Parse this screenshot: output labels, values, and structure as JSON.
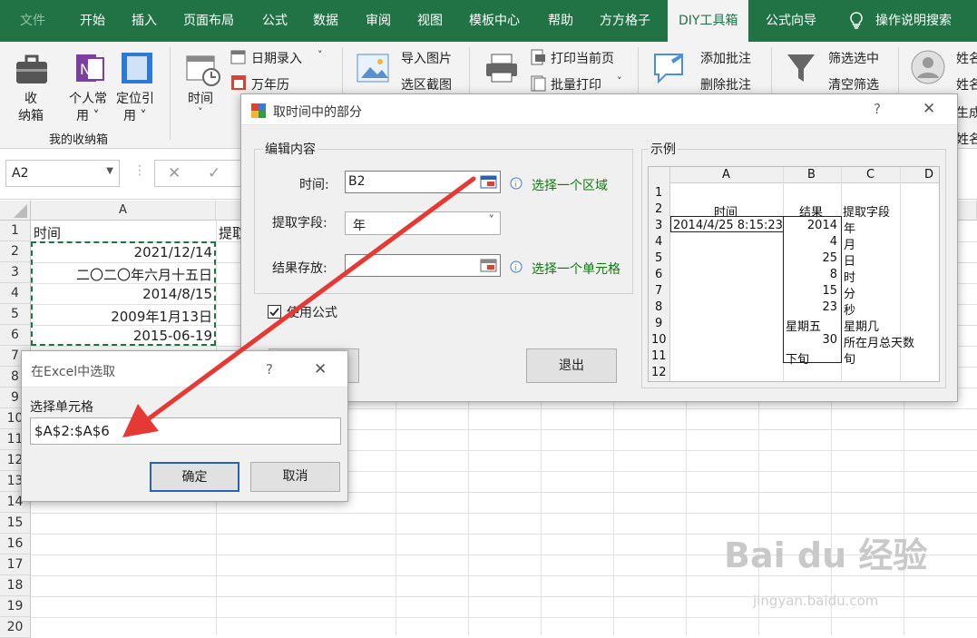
{
  "ribbon_tabs": [
    "文件",
    "开始",
    "插入",
    "页面布局",
    "公式",
    "数据",
    "审阅",
    "视图",
    "模板中心",
    "帮助",
    "方方格子",
    "DIY工具箱",
    "公式向导",
    "操作说明搜索"
  ],
  "ribbon": {
    "box_label_1": "收",
    "box_label_2": "纳箱",
    "personal_label": "个人常",
    "personal_sub": "用 ˅",
    "locate_label": "定位引",
    "locate_sub": "用 ˅",
    "time_label": "时间",
    "time_sub": "˅",
    "date_entry": "日期录入",
    "perpetual": "万年历",
    "import_image": "导入图片",
    "area_screenshot": "选区截图",
    "print_current": "打印当前页",
    "batch_print": "批量打印",
    "add_comment": "添加批注",
    "delete_comment": "删除批注",
    "filter_selected": "筛选选中",
    "clear_filter": "清空筛选",
    "name_1": "姓名",
    "name_2": "姓名",
    "name_3": "生成",
    "name_4": "姓名",
    "group_label": "我的收纳箱"
  },
  "formula_bar": {
    "name_box": "A2",
    "cancel_symbol": "✕",
    "confirm_symbol": "✓"
  },
  "sheet": {
    "columns": [
      "A"
    ],
    "rows": [
      "1",
      "2",
      "3",
      "4",
      "5",
      "6",
      "7",
      "8",
      "9",
      "10",
      "11",
      "12",
      "13",
      "14",
      "15",
      "16",
      "17",
      "18",
      "19",
      "20"
    ],
    "a1": "时间",
    "b1": "提取",
    "a2": "2021/12/14",
    "a3": "二〇二〇年六月十五日",
    "a4": "2014/8/15",
    "a5": "2009年1月13日",
    "a6": "2015-06-19"
  },
  "main_dialog": {
    "title": "取时间中的部分",
    "help": "?",
    "close": "✕",
    "edit_group": "编辑内容",
    "time_label": "时间:",
    "time_value": "B2",
    "time_hint": "选择一个区域",
    "field_label": "提取字段:",
    "field_value": "年",
    "result_label": "结果存放:",
    "result_value": "",
    "result_hint": "选择一个单元格",
    "use_formula": "使用公式",
    "use_formula_checked": true,
    "exit_button": "退出",
    "example_group": "示例",
    "example": {
      "cols": [
        "A",
        "B",
        "C",
        "D"
      ],
      "rows": [
        "1",
        "2",
        "3",
        "4",
        "5",
        "6",
        "7",
        "8",
        "9",
        "10",
        "11",
        "12"
      ],
      "a2": "时间",
      "b2": "结果",
      "c2": "提取字段",
      "a3": "2014/4/25 8:15:23",
      "b": [
        "2014",
        "4",
        "25",
        "8",
        "15",
        "23",
        "星期五",
        "30",
        "下旬"
      ],
      "c": [
        "年",
        "月",
        "日",
        "时",
        "分",
        "秒",
        "星期几",
        "所在月总天数",
        "旬"
      ]
    }
  },
  "select_dialog": {
    "title": "在Excel中选取",
    "help": "?",
    "close": "✕",
    "label": "选择单元格",
    "value": "$A$2:$A$6",
    "ok": "确定",
    "cancel": "取消"
  },
  "watermark": {
    "text": "Bai du 经验",
    "url": "jingyan.baidu.com"
  },
  "colors": {
    "excel_green": "#217346",
    "arrow": "#e53935",
    "hint_green": "#0e7a0e"
  }
}
